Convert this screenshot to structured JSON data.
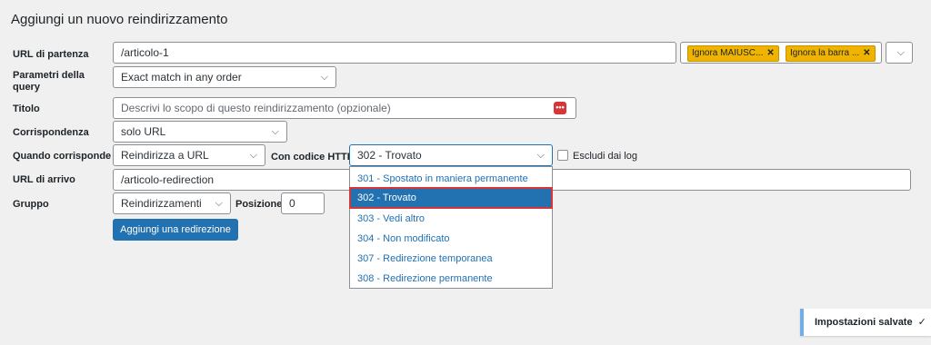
{
  "heading": "Aggiungi un nuovo reindirizzamento",
  "labels": {
    "source": "URL di partenza",
    "query_params": "Parametri della query",
    "title": "Titolo",
    "match": "Corrispondenza",
    "when_matches": "Quando corrisponde",
    "target": "URL di arrivo",
    "group": "Gruppo"
  },
  "source": {
    "value": "/articolo-1",
    "tags": [
      "Ignora MAIUSC...",
      "Ignora la barra ..."
    ],
    "tag_remove_icon": "close-icon"
  },
  "query_params": {
    "selected": "Exact match in any order"
  },
  "title": {
    "placeholder": "Descrivi lo scopo di questo reindirizzamento (opzionale)",
    "icon": "more-icon"
  },
  "match": {
    "selected": "solo URL"
  },
  "action": {
    "selected": "Reindirizza a URL"
  },
  "http_code": {
    "label": "Con codice HTTP",
    "selected": "302 - Trovato",
    "options": [
      "301 - Spostato in maniera permanente",
      "302 - Trovato",
      "303 - Vedi altro",
      "304 - Non modificato",
      "307 - Redirezione temporanea",
      "308 - Redirezione permanente"
    ],
    "highlighted_index": 1
  },
  "exclude_log": {
    "label": "Escludi dai log",
    "checked": false
  },
  "target": {
    "value": "/articolo-redirection"
  },
  "group": {
    "selected": "Reindirizzamenti",
    "position_label": "Posizione",
    "position_value": "0"
  },
  "add_button": "Aggiungi una redirezione",
  "notice": {
    "text": "Impostazioni salvate",
    "icon": "check-icon"
  },
  "colors": {
    "accent": "#2271b1",
    "tag": "#f0b400",
    "highlight_border": "#d63638"
  }
}
